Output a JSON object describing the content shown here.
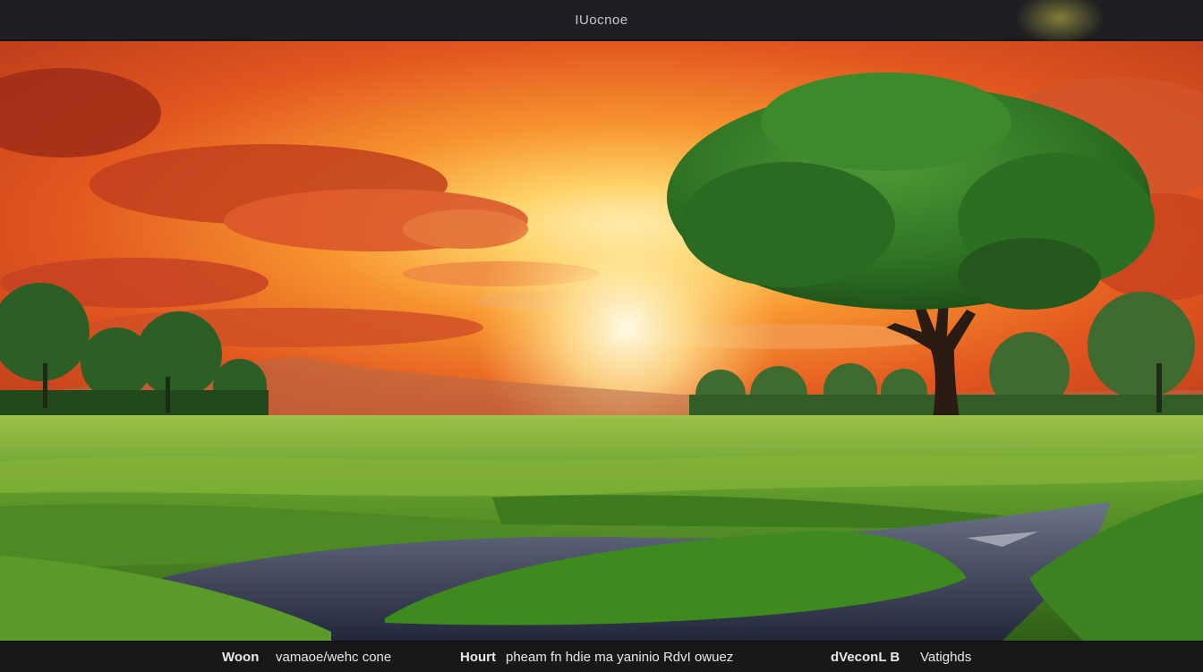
{
  "window": {
    "title": "IUocnoe"
  },
  "scene": {
    "subject": "sunset-landscape-with-tree-and-stream",
    "colors": {
      "sky_top": "#b8361c",
      "sun": "#ffe9a0",
      "foliage": "#2e7a26",
      "grass": "#7fb83a",
      "water": "#3a3f52"
    }
  },
  "footer": {
    "item1_bold": "Woon",
    "item1_text": "vamaoe/wehc cone",
    "item2_bold": "Hourt",
    "item2_text": "pheam fn hdie ma yaninio RdvI owuez",
    "item3_bold": "dVeconL B",
    "item3_text": "Vatighds"
  }
}
